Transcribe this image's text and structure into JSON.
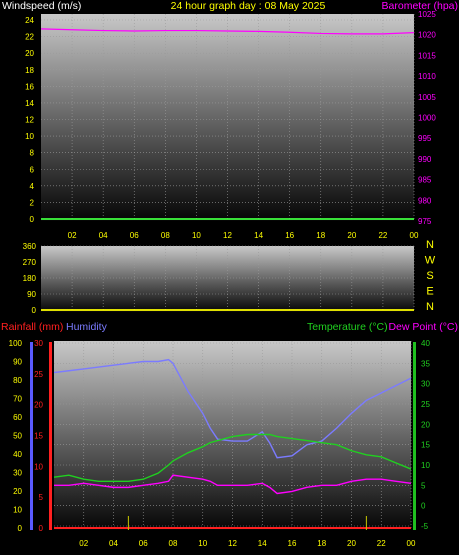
{
  "top": {
    "title": "24 hour graph day : 08 May 2025",
    "left_label": "Windspeed (m/s)",
    "right_label": "Barometer (hpa)",
    "left_ticks": [
      "0",
      "2",
      "4",
      "6",
      "8",
      "10",
      "12",
      "14",
      "16",
      "18",
      "20",
      "22",
      "24"
    ],
    "right_ticks": [
      "975",
      "980",
      "985",
      "990",
      "995",
      "1000",
      "1005",
      "1010",
      "1015",
      "1020",
      "1025"
    ]
  },
  "mid": {
    "left_ticks": [
      "0",
      "90",
      "180",
      "270",
      "360"
    ],
    "direction_letters": [
      "N",
      "W",
      "S",
      "E",
      "N"
    ]
  },
  "bottom": {
    "rain_label": "Rainfall (mm)",
    "humidity_label": "Humidity",
    "temp_label": "Temperature (°C)",
    "dew_label": "Dew Point (°C)",
    "humidity_ticks": [
      "0",
      "10",
      "20",
      "30",
      "40",
      "50",
      "60",
      "70",
      "80",
      "90",
      "100"
    ],
    "rain_ticks": [
      "0",
      "5",
      "10",
      "15",
      "20",
      "25",
      "30"
    ],
    "temp_ticks": [
      "-5",
      "0",
      "5",
      "10",
      "15",
      "20",
      "25",
      "30",
      "35",
      "40"
    ]
  },
  "x_ticks": [
    "02",
    "04",
    "06",
    "08",
    "10",
    "12",
    "14",
    "16",
    "18",
    "20",
    "22",
    "00"
  ],
  "colors": {
    "windspeed": "#40ff40",
    "barometer": "#ff00ff",
    "humidity": "#7b7bff",
    "rainfall": "#ff2020",
    "temperature": "#20d020",
    "dewpoint": "#ff00ff",
    "title": "#ffff00",
    "tick": "#ffff00",
    "winddir": "#ffff00"
  },
  "chart_data": [
    {
      "type": "line",
      "x": [
        0,
        2,
        4,
        6,
        8,
        10,
        12,
        14,
        16,
        18,
        20,
        22,
        24
      ],
      "series": [
        {
          "name": "Windspeed (m/s)",
          "axis": "left",
          "values": [
            0,
            0,
            0,
            0,
            0,
            0,
            0,
            0,
            0,
            0,
            0,
            0,
            0
          ]
        },
        {
          "name": "Barometer (hpa)",
          "axis": "right",
          "values": [
            1021.4,
            1021.2,
            1021.0,
            1020.9,
            1021.0,
            1021.0,
            1020.9,
            1020.8,
            1020.6,
            1020.3,
            1020.2,
            1020.2,
            1020.5
          ]
        }
      ],
      "ylim_left": [
        0,
        24
      ],
      "ylim_right": [
        975,
        1025
      ]
    },
    {
      "type": "line",
      "x": [
        0,
        2,
        4,
        6,
        8,
        10,
        12,
        14,
        16,
        18,
        20,
        22,
        24
      ],
      "series": [
        {
          "name": "Wind direction",
          "values": [
            0,
            0,
            0,
            0,
            0,
            0,
            0,
            0,
            0,
            0,
            0,
            0,
            0
          ]
        }
      ],
      "ylim": [
        0,
        360
      ]
    },
    {
      "type": "line",
      "x": [
        0,
        1,
        2,
        3,
        4,
        5,
        6,
        7,
        7.7,
        8,
        9,
        10,
        10.5,
        11,
        12,
        13,
        14,
        14.5,
        15,
        16,
        17,
        18,
        19,
        20,
        21,
        22,
        23,
        24
      ],
      "series": [
        {
          "name": "Humidity",
          "axis": "humidity",
          "values": [
            84,
            85,
            86,
            87,
            88,
            89,
            90,
            90,
            91,
            89,
            74,
            62,
            54,
            48,
            47,
            47,
            52,
            46,
            38,
            39,
            45,
            47,
            54,
            62,
            69,
            73,
            77,
            81
          ]
        },
        {
          "name": "Temperature (°C)",
          "axis": "temp",
          "values": [
            7,
            7.5,
            6.5,
            6,
            6,
            6,
            6.5,
            8,
            10,
            11,
            13,
            14.5,
            15.5,
            16,
            17,
            17.5,
            17.5,
            17.5,
            17,
            16.5,
            16,
            15.5,
            15,
            13.5,
            12.5,
            12,
            10.5,
            9
          ]
        },
        {
          "name": "Dew Point (°C)",
          "axis": "temp",
          "values": [
            5,
            5,
            5.5,
            5,
            4.5,
            4.5,
            5,
            5.5,
            6,
            7.5,
            7,
            6.5,
            6,
            5,
            5,
            5,
            5.5,
            4.5,
            3,
            3.5,
            4.5,
            5,
            5,
            6,
            6.5,
            6.5,
            6,
            5.5
          ]
        },
        {
          "name": "Rainfall (mm)",
          "axis": "rain",
          "values": [
            0,
            0,
            0,
            0,
            0,
            0,
            0,
            0,
            0,
            0,
            0,
            0,
            0,
            0,
            0,
            0,
            0,
            0,
            0,
            0,
            0,
            0,
            0,
            0,
            0,
            0,
            0,
            0
          ]
        }
      ],
      "ylim_humidity": [
        0,
        100
      ],
      "ylim_rain": [
        0,
        30
      ],
      "ylim_temp": [
        -5,
        40
      ]
    }
  ]
}
